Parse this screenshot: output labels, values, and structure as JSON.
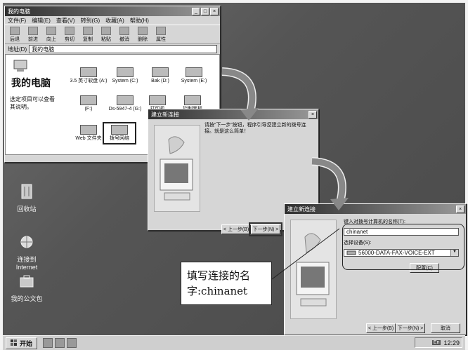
{
  "desktop_icons": [
    {
      "label": "回收站",
      "icon": "recycle-bin-icon"
    },
    {
      "label": "连接到\nInternet",
      "icon": "connect-internet-icon"
    },
    {
      "label": "我的公文包",
      "icon": "briefcase-icon"
    }
  ],
  "taskbar": {
    "start_label": "开始",
    "clock": "12:29",
    "tray_lang": "En"
  },
  "explorer": {
    "title": "我的电脑",
    "menu": [
      "文件(F)",
      "编辑(E)",
      "查看(V)",
      "转到(G)",
      "收藏(A)",
      "帮助(H)"
    ],
    "tools": [
      "后退",
      "前进",
      "向上",
      "剪切",
      "复制",
      "粘贴",
      "撤消",
      "删除",
      "属性"
    ],
    "address_label": "地址(D)",
    "address_value": "我的电脑",
    "heading": "我的电脑",
    "description": "选定项目可以查看其说明。",
    "drives": [
      {
        "label": "3.5 英寸软盘 (A:)"
      },
      {
        "label": "System (C:)"
      },
      {
        "label": "Bak (D:)"
      },
      {
        "label": "System (E:)"
      },
      {
        "label": "(F:)"
      },
      {
        "label": "Ds-5947-4 (G:)"
      },
      {
        "label": "打印机"
      },
      {
        "label": "控制面板"
      },
      {
        "label": "Web 文件夹"
      },
      {
        "label": "拨号网络"
      }
    ]
  },
  "wizard1": {
    "title": "建立新连接",
    "text": "请按“下一步”按钮，程序引导您建立新的拨号连接。就是这么简单！",
    "back_label": "< 上一步(B)",
    "next_label": "下一步(N) >"
  },
  "wizard2": {
    "title": "建立新连接",
    "name_label": "键入对拨号计算机的名称(T):",
    "name_value": "chinanet",
    "device_label": "选择设备(S):",
    "device_value": "56000-DATA-FAX-VOICE-EXT",
    "config_label": "配置(C)",
    "back_label": "< 上一步(B)",
    "next_label": "下一步(N) >",
    "cancel_label": "取消"
  },
  "callout": {
    "text": "填写连接的名字:chinanet"
  }
}
